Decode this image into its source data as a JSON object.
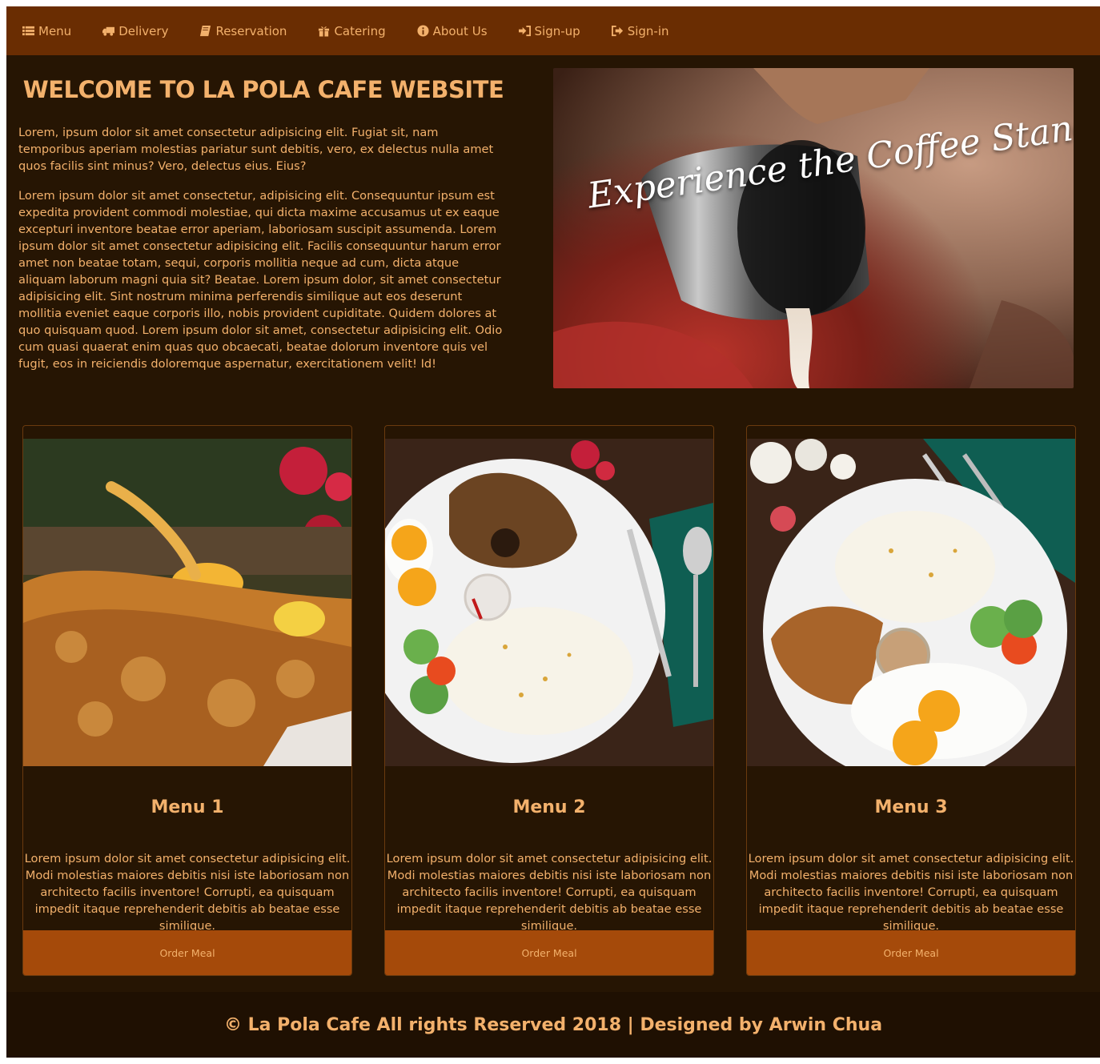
{
  "colors": {
    "nav_bg": "#6a2d02",
    "page_bg": "#261503",
    "accent_text": "#f3b16c",
    "button_bg": "#a54a0a",
    "footer_bg": "#1f1002"
  },
  "nav": {
    "items": [
      {
        "label": "Menu",
        "icon": "list-icon"
      },
      {
        "label": "Delivery",
        "icon": "truck-icon"
      },
      {
        "label": "Reservation",
        "icon": "book-icon"
      },
      {
        "label": "Catering",
        "icon": "gift-icon"
      },
      {
        "label": "About Us",
        "icon": "info-icon"
      },
      {
        "label": "Sign-up",
        "icon": "sign-in-icon"
      },
      {
        "label": "Sign-in",
        "icon": "sign-out-icon"
      }
    ]
  },
  "intro": {
    "title": "WELCOME TO LA POLA CAFE WEBSITE",
    "paragraph1": "Lorem, ipsum dolor sit amet consectetur adipisicing elit. Fugiat sit, nam temporibus aperiam molestias pariatur sunt debitis, vero, ex delectus nulla amet quos facilis sint minus? Vero, delectus eius. Eius?",
    "paragraph2": "Lorem ipsum dolor sit amet consectetur, adipisicing elit. Consequuntur ipsum est expedita provident commodi molestiae, qui dicta maxime accusamus ut ex eaque excepturi inventore beatae error aperiam, laboriosam suscipit assumenda. Lorem ipsum dolor sit amet consectetur adipisicing elit. Facilis consequuntur harum error amet non beatae totam, sequi, corporis mollitia neque ad cum, dicta atque aliquam laborum magni quia sit? Beatae. Lorem ipsum dolor, sit amet consectetur adipisicing elit. Sint nostrum minima perferendis similique aut eos deserunt mollitia eveniet eaque corporis illo, nobis provident cupiditate. Quidem dolores at quo quisquam quod. Lorem ipsum dolor sit amet, consectetur adipisicing elit. Odio cum quasi quaerat enim quas quo obcaecati, beatae dolorum inventore quis vel fugit, eos in reiciendis doloremque aspernatur, exercitationem velit! Id!"
  },
  "hero": {
    "overlay_text": "Experience the Coffee Standard"
  },
  "cards": [
    {
      "title": "Menu 1",
      "text": "Lorem ipsum dolor sit amet consectetur adipisicing elit. Modi molestias maiores debitis nisi iste laboriosam non architecto facilis inventore! Corrupti, ea quisquam impedit itaque reprehenderit debitis ab beatae esse similique.",
      "button": "Order Meal"
    },
    {
      "title": "Menu 2",
      "text": "Lorem ipsum dolor sit amet consectetur adipisicing elit. Modi molestias maiores debitis nisi iste laboriosam non architecto facilis inventore! Corrupti, ea quisquam impedit itaque reprehenderit debitis ab beatae esse similique.",
      "button": "Order Meal"
    },
    {
      "title": "Menu 3",
      "text": "Lorem ipsum dolor sit amet consectetur adipisicing elit. Modi molestias maiores debitis nisi iste laboriosam non architecto facilis inventore! Corrupti, ea quisquam impedit itaque reprehenderit debitis ab beatae esse similique.",
      "button": "Order Meal"
    }
  ],
  "footer": {
    "text": "© La Pola Cafe All rights Reserved 2018 | Designed by Arwin Chua"
  }
}
